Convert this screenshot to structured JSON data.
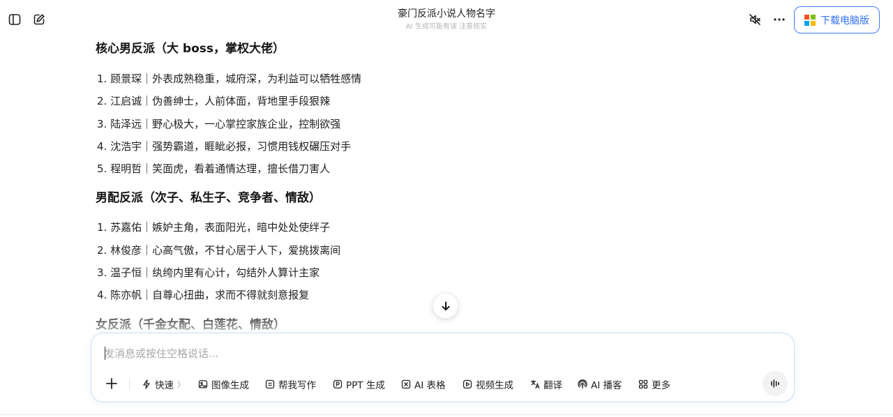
{
  "header": {
    "title": "豪门反派小说人物名字",
    "subtitle": "AI 生成可能有误 注意核实",
    "download_label": "下载电脑版",
    "icons": [
      "sidebar-toggle-icon",
      "new-chat-icon",
      "mute-icon",
      "more-icon"
    ]
  },
  "sections": [
    {
      "title": "核心男反派（大 boss，掌权大佬）",
      "items": [
        "1. 顾景琛｜外表成熟稳重，城府深，为利益可以牺牲感情",
        "2. 江启诚｜伪善绅士，人前体面，背地里手段狠辣",
        "3. 陆泽远｜野心极大，一心掌控家族企业，控制欲强",
        "4. 沈浩宇｜强势霸道，睚眦必报，习惯用钱权碾压对手",
        "5. 程明哲｜笑面虎，看着通情达理，擅长借刀害人"
      ]
    },
    {
      "title": "男配反派（次子、私生子、竞争者、情敌）",
      "items": [
        "1. 苏嘉佑｜嫉妒主角，表面阳光，暗中处处使绊子",
        "2. 林俊彦｜心高气傲，不甘心居于人下，爱挑拨离间",
        "3. 温子恒｜纨绔内里有心计，勾结外人算计主家",
        "4. 陈亦帆｜自尊心扭曲，求而不得就刻意报复"
      ]
    },
    {
      "title": "女反派（千金女配、白莲花、情敌）",
      "items": []
    }
  ],
  "composer": {
    "placeholder": "发消息或按住空格说话...",
    "tools": [
      {
        "label": "快速",
        "icon": "lightning-icon"
      },
      {
        "label": "图像生成",
        "icon": "image-icon"
      },
      {
        "label": "帮我写作",
        "icon": "write-icon"
      },
      {
        "label": "PPT 生成",
        "icon": "ppt-icon"
      },
      {
        "label": "AI 表格",
        "icon": "table-icon"
      },
      {
        "label": "视频生成",
        "icon": "video-icon"
      },
      {
        "label": "翻译",
        "icon": "translate-icon"
      },
      {
        "label": "AI 播客",
        "icon": "podcast-icon"
      },
      {
        "label": "更多",
        "icon": "grid-icon"
      }
    ],
    "chevron": "〉"
  },
  "colors": {
    "accent": "#2f6ff2",
    "composer_border": "#c9dcf8"
  }
}
